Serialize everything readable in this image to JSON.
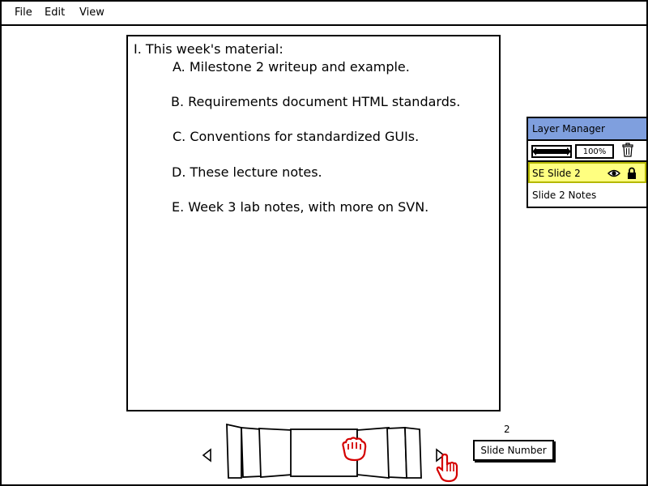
{
  "menubar": {
    "items": [
      "File",
      "Edit",
      "View"
    ]
  },
  "slide": {
    "heading": "I. This week's material:",
    "bullets": [
      "A. Milestone 2 writeup and example.",
      "B. Requirements document HTML standards.",
      "C. Conventions for standardized GUIs.",
      "D. These lecture notes.",
      "E. Week 3 lab notes, with more on SVN."
    ]
  },
  "layer_manager": {
    "title": "Layer Manager",
    "zoom": "100%",
    "layers": [
      {
        "name": "SE Slide 2",
        "selected": true,
        "visible_icon": "eye-icon",
        "lock_icon": "lock-icon"
      },
      {
        "name": "Slide 2 Notes",
        "selected": false
      }
    ],
    "trash_icon": "trash-icon"
  },
  "navigator": {
    "prev_icon": "triangle-left-icon",
    "next_icon": "triangle-right-icon",
    "slide_number": "2",
    "slide_number_label": "Slide Number"
  },
  "colors": {
    "layer_title_bg": "#7f9fde",
    "selected_layer_bg": "#ffff80",
    "hand_cursor": "#d40000"
  }
}
